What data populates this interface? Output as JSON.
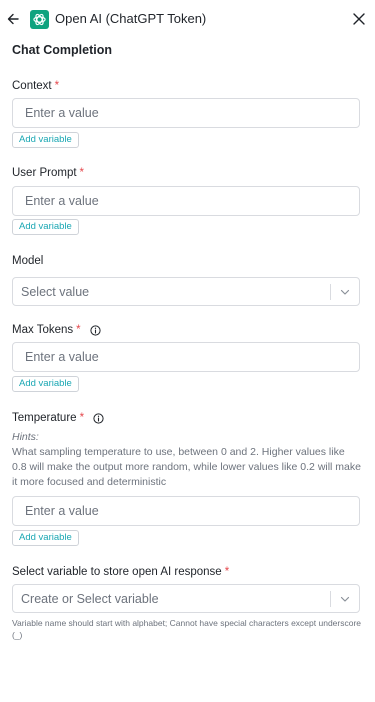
{
  "header": {
    "title": "Open AI (ChatGPT Token)",
    "back_icon": "arrow-left-icon",
    "logo_icon": "openai-logo-icon",
    "close_icon": "close-icon",
    "logo_color": "#10a37f"
  },
  "section_title": "Chat Completion",
  "required_marker": "*",
  "fields": {
    "context": {
      "label": "Context",
      "placeholder": "Enter a value",
      "add_variable": "Add variable"
    },
    "user_prompt": {
      "label": "User Prompt",
      "placeholder": "Enter a value",
      "add_variable": "Add variable"
    },
    "model": {
      "label": "Model",
      "placeholder": "Select value"
    },
    "max_tokens": {
      "label": "Max Tokens",
      "placeholder": "Enter a value",
      "add_variable": "Add variable"
    },
    "temperature": {
      "label": "Temperature",
      "hints_label": "Hints:",
      "hints": "What sampling temperature to use, between 0 and 2. Higher values like 0.8 will make the output more random, while lower values like 0.2 will make it more focused and deterministic",
      "placeholder": "Enter a value",
      "add_variable": "Add variable"
    },
    "store_variable": {
      "label": "Select variable to store open AI response",
      "placeholder": "Create or Select variable",
      "help": "Variable name should start with alphabet; Cannot have special characters except underscore (_)"
    }
  },
  "colors": {
    "required": "#e5484d",
    "add_variable_text": "#1aa7b3",
    "muted_text": "#6d737d",
    "border": "#d9dbe0"
  }
}
